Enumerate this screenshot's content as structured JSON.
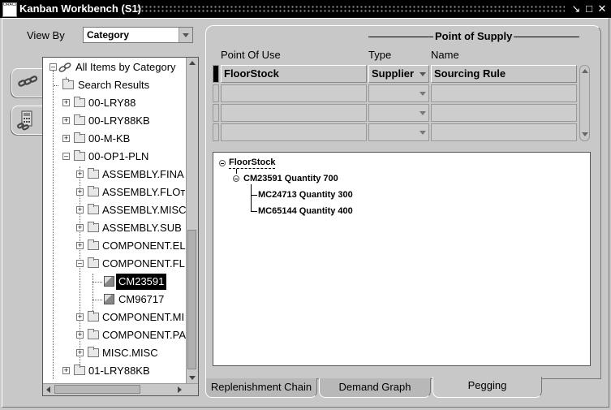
{
  "window": {
    "title": "Kanban Workbench (S1)",
    "app_icon_text": "ORACLE",
    "controls": [
      "minimize-icon",
      "restore-icon",
      "close-icon"
    ]
  },
  "view_by": {
    "label": "View By",
    "selected": "Category"
  },
  "side_tabs": [
    {
      "name": "chain-icon"
    },
    {
      "name": "calculator-icon"
    }
  ],
  "tree": {
    "items": [
      {
        "label": "All Items by Category",
        "type": "root",
        "expanded": true
      },
      {
        "label": "Search Results",
        "type": "folder"
      },
      {
        "label": "00-LRY88",
        "type": "folder",
        "expanded": false
      },
      {
        "label": "00-LRY88KB",
        "type": "folder",
        "expanded": false
      },
      {
        "label": "00-M-KB",
        "type": "folder",
        "expanded": false
      },
      {
        "label": "00-OP1-PLN",
        "type": "folder",
        "expanded": true
      },
      {
        "label": "ASSEMBLY.FINA",
        "type": "folder",
        "expanded": false
      },
      {
        "label": "ASSEMBLY.FLOт",
        "type": "folder",
        "expanded": false
      },
      {
        "label": "ASSEMBLY.MISC",
        "type": "folder",
        "expanded": false
      },
      {
        "label": "ASSEMBLY.SUB",
        "type": "folder",
        "expanded": false
      },
      {
        "label": "COMPONENT.EL",
        "type": "folder",
        "expanded": false
      },
      {
        "label": "COMPONENT.FL",
        "type": "folder",
        "expanded": true
      },
      {
        "label": "CM23591",
        "type": "item",
        "selected": true
      },
      {
        "label": "CM96717",
        "type": "item"
      },
      {
        "label": "COMPONENT.MI",
        "type": "folder",
        "expanded": false
      },
      {
        "label": "COMPONENT.PA",
        "type": "folder",
        "expanded": false
      },
      {
        "label": "MISC.MISC",
        "type": "folder",
        "expanded": false
      },
      {
        "label": "01-LRY88KB",
        "type": "folder",
        "expanded": false
      }
    ]
  },
  "grid": {
    "group_header": "Point of Supply",
    "headers": {
      "point_of_use": "Point Of Use",
      "type": "Type",
      "name": "Name"
    },
    "rows": [
      {
        "point_of_use": "FloorStock",
        "type": "Supplier",
        "name": "Sourcing Rule"
      },
      {
        "point_of_use": "",
        "type": "",
        "name": ""
      },
      {
        "point_of_use": "",
        "type": "",
        "name": ""
      },
      {
        "point_of_use": "",
        "type": "",
        "name": ""
      }
    ]
  },
  "pegging": {
    "root": "FloorStock",
    "child": "CM23591 Quantity 700",
    "grandchildren": [
      "MC24713 Quantity 300",
      "MC65144 Quantity 400"
    ]
  },
  "tabs": [
    {
      "label": "Replenishment Chain",
      "active": false
    },
    {
      "label": "Demand Graph",
      "active": false
    },
    {
      "label": "Pegging",
      "active": true
    }
  ]
}
